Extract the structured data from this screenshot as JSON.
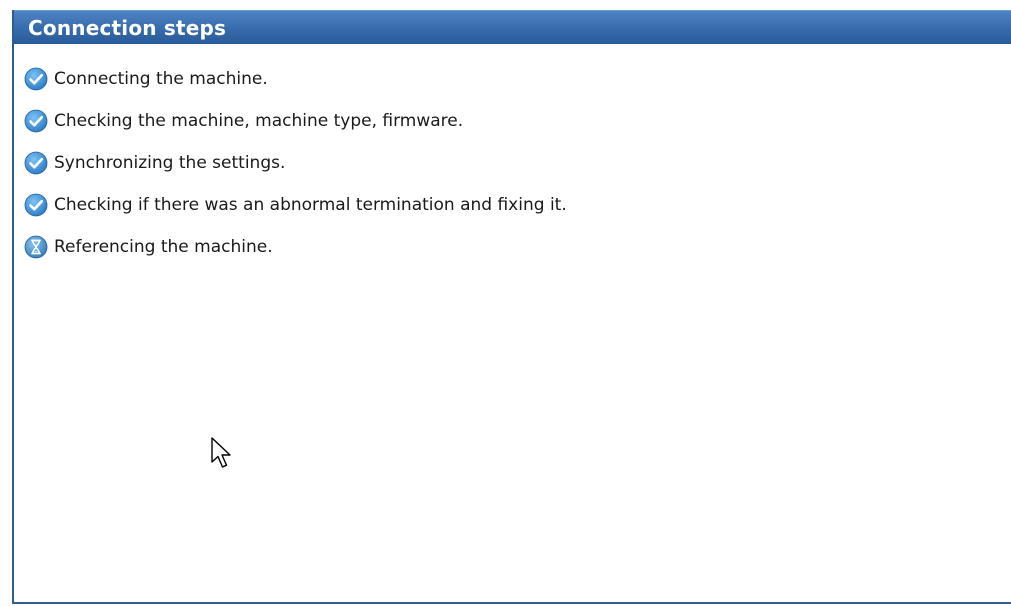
{
  "panel": {
    "title": "Connection steps"
  },
  "steps": [
    {
      "label": "Connecting the machine.",
      "status": "done",
      "icon": "checkmark-icon"
    },
    {
      "label": "Checking the machine, machine type, firmware.",
      "status": "done",
      "icon": "checkmark-icon"
    },
    {
      "label": "Synchronizing the settings.",
      "status": "done",
      "icon": "checkmark-icon"
    },
    {
      "label": "Checking if there was an abnormal termination and fixing it.",
      "status": "done",
      "icon": "checkmark-icon"
    },
    {
      "label": "Referencing the machine.",
      "status": "in-progress",
      "icon": "hourglass-icon"
    }
  ],
  "colors": {
    "header": "#3a6fb0",
    "icon_blue": "#3b8fd6"
  }
}
